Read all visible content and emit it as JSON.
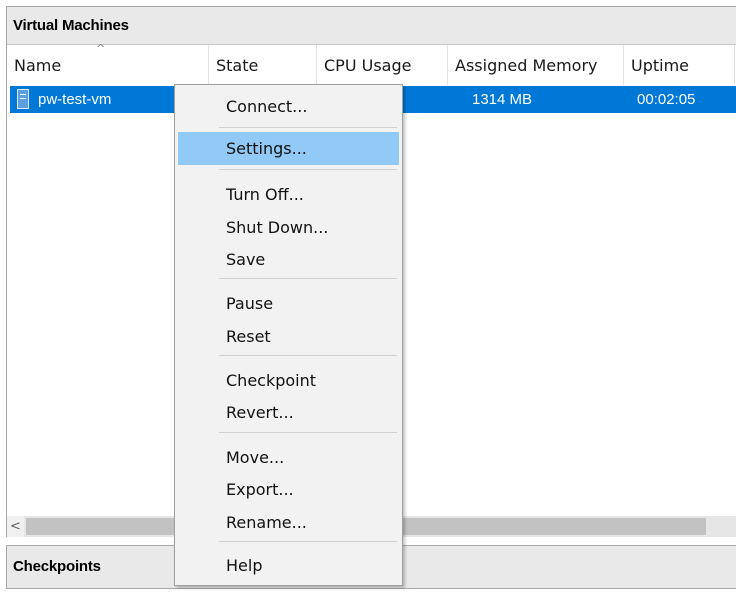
{
  "vm_panel": {
    "title": "Virtual Machines",
    "columns": [
      {
        "key": "name",
        "label": "Name"
      },
      {
        "key": "state",
        "label": "State"
      },
      {
        "key": "cpu",
        "label": "CPU Usage"
      },
      {
        "key": "memory",
        "label": "Assigned Memory"
      },
      {
        "key": "uptime",
        "label": "Uptime"
      }
    ],
    "sort_indicator": "^",
    "rows": [
      {
        "name": "pw-test-vm",
        "memory": "1314 MB",
        "uptime": "00:02:05",
        "selected": true
      }
    ],
    "scroll_left_glyph": "<"
  },
  "checkpoints_panel": {
    "title": "Checkpoints"
  },
  "context_menu": {
    "items": [
      {
        "label": "Connect...",
        "group": 1
      },
      {
        "label": "Settings...",
        "group": 2,
        "highlighted": true
      },
      {
        "label": "Turn Off...",
        "group": 3
      },
      {
        "label": "Shut Down...",
        "group": 3
      },
      {
        "label": "Save",
        "group": 3
      },
      {
        "label": "Pause",
        "group": 4
      },
      {
        "label": "Reset",
        "group": 4
      },
      {
        "label": "Checkpoint",
        "group": 5
      },
      {
        "label": "Revert...",
        "group": 5
      },
      {
        "label": "Move...",
        "group": 6
      },
      {
        "label": "Export...",
        "group": 6
      },
      {
        "label": "Rename...",
        "group": 6
      },
      {
        "label": "Help",
        "group": 7
      }
    ]
  },
  "colors": {
    "selection": "#0078d7",
    "menu_highlight": "#91c9f7",
    "panel_header": "#e9e9e9",
    "menu_background": "#f2f2f2"
  }
}
